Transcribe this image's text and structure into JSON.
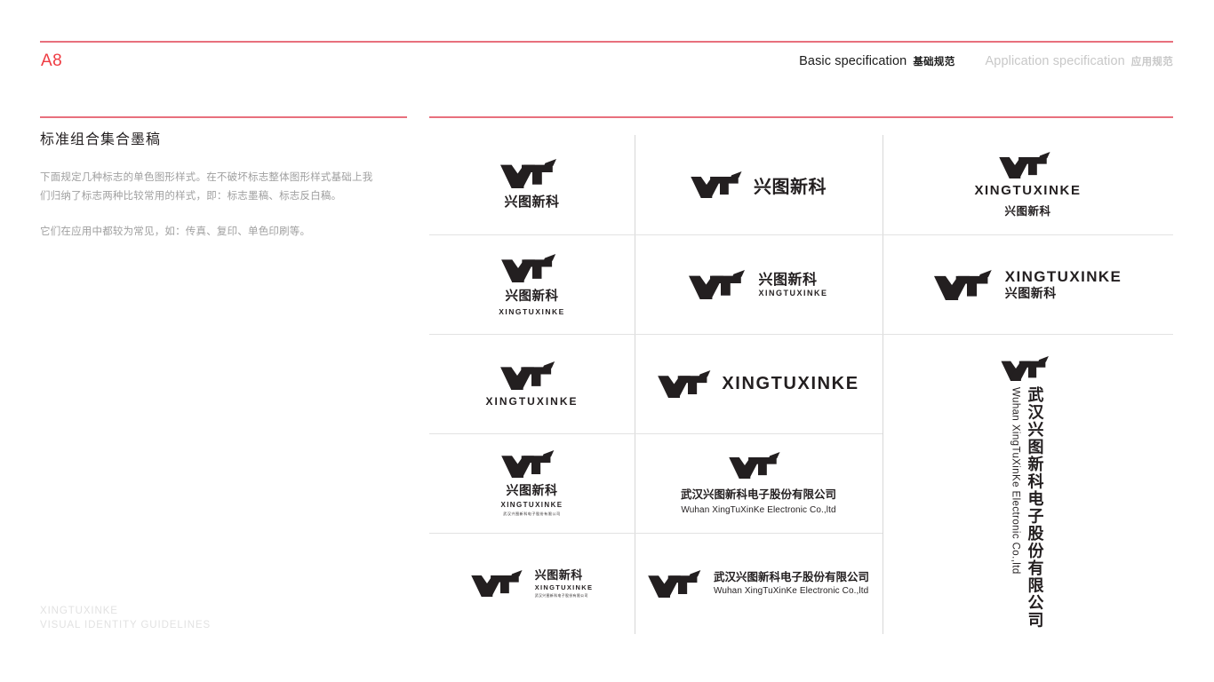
{
  "header": {
    "page_code": "A8",
    "nav": [
      {
        "en": "Basic specification",
        "cn": "基础规范",
        "state": "active"
      },
      {
        "en": "Application specification",
        "cn": "应用规范",
        "state": "inactive"
      }
    ],
    "rule_color": "#e8707d",
    "accent_color": "#ef3b42"
  },
  "section": {
    "title": "标准组合集合墨稿",
    "paragraphs": [
      "下面规定几种标志的单色图形样式。在不破坏标志整体图形样式基础上我们归纳了标志两种比较常用的样式，即：标志墨稿、标志反白稿。",
      "它们在应用中都较为常见，如：传真、复印、单色印刷等。"
    ]
  },
  "footer": {
    "line1": "XINGTUXINKE",
    "line2": "VISUAL IDENTITY GUIDELINES"
  },
  "brand": {
    "mark_name": "XT",
    "cn_short": "兴图新科",
    "en_short": "XINGTUXINKE",
    "cn_full": "武汉兴图新科电子股份有限公司",
    "en_full": "Wuhan XingTuXinKe Electronic Co.,ltd",
    "ink_color": "#231f20"
  },
  "grid": {
    "column_a": [
      {
        "name": "mark-over-cn",
        "layout": "stacked"
      },
      {
        "name": "mark-over-cn-en",
        "layout": "stacked"
      },
      {
        "name": "mark-over-en",
        "layout": "stacked"
      },
      {
        "name": "mark-over-cn-en-micro",
        "layout": "stacked"
      },
      {
        "name": "mark-left-cn-en-micro",
        "layout": "horizontal"
      }
    ],
    "column_b": [
      {
        "name": "mark-left-cn",
        "layout": "horizontal"
      },
      {
        "name": "mark-left-cn-en",
        "layout": "horizontal"
      },
      {
        "name": "mark-left-en",
        "layout": "horizontal"
      },
      {
        "name": "mark-over-cnfull-enfull",
        "layout": "stacked"
      },
      {
        "name": "mark-left-cnfull-enfull",
        "layout": "horizontal"
      }
    ],
    "column_c": [
      {
        "name": "mark-over-en-cn",
        "layout": "stacked"
      },
      {
        "name": "mark-left-en-cn",
        "layout": "horizontal"
      },
      {
        "name": "mark-over-vertical-full",
        "layout": "vertical"
      }
    ]
  }
}
